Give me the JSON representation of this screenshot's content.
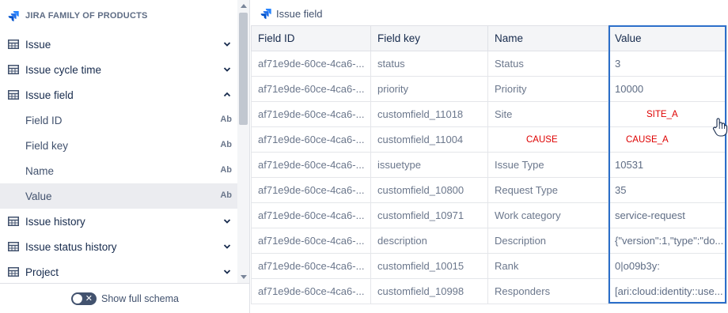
{
  "sidebar": {
    "header": {
      "title": "JIRA FAMILY OF PRODUCTS"
    },
    "tables": [
      {
        "label": "Issue",
        "expanded": false
      },
      {
        "label": "Issue cycle time",
        "expanded": false
      },
      {
        "label": "Issue field",
        "expanded": true,
        "fields": [
          {
            "label": "Field ID",
            "type": "Ab"
          },
          {
            "label": "Field key",
            "type": "Ab"
          },
          {
            "label": "Name",
            "type": "Ab"
          },
          {
            "label": "Value",
            "type": "Ab",
            "selected": true
          }
        ]
      },
      {
        "label": "Issue history",
        "expanded": false
      },
      {
        "label": "Issue status history",
        "expanded": false
      },
      {
        "label": "Project",
        "expanded": false
      }
    ],
    "footer": {
      "toggle_label": "Show full schema",
      "toggle_on": false
    }
  },
  "main": {
    "title": "Issue field",
    "columns": [
      "Field ID",
      "Field key",
      "Name",
      "Value"
    ],
    "rows": [
      [
        "af71e9de-60ce-4ca6-...",
        "status",
        "Status",
        "3"
      ],
      [
        "af71e9de-60ce-4ca6-...",
        "priority",
        "Priority",
        "10000"
      ],
      [
        "af71e9de-60ce-4ca6-...",
        "customfield_11018",
        "Site",
        "SITE_A"
      ],
      [
        "af71e9de-60ce-4ca6-...",
        "customfield_11004",
        "CAUSE",
        "CAUSE_A"
      ],
      [
        "af71e9de-60ce-4ca6-...",
        "issuetype",
        "Issue Type",
        "10531"
      ],
      [
        "af71e9de-60ce-4ca6-...",
        "customfield_10800",
        "Request Type",
        "35"
      ],
      [
        "af71e9de-60ce-4ca6-...",
        "customfield_10971",
        "Work category",
        "service-request"
      ],
      [
        "af71e9de-60ce-4ca6-...",
        "description",
        "Description",
        "{\"version\":1,\"type\":\"do..."
      ],
      [
        "af71e9de-60ce-4ca6-...",
        "customfield_10015",
        "Rank",
        "0|o09b3y:"
      ],
      [
        "af71e9de-60ce-4ca6-...",
        "customfield_10998",
        "Responders",
        "[ari:cloud:identity::use..."
      ]
    ]
  },
  "colors": {
    "accent": "#2c6fca",
    "redacted_text": "#de0000",
    "brand_blue": "#2684ff"
  }
}
